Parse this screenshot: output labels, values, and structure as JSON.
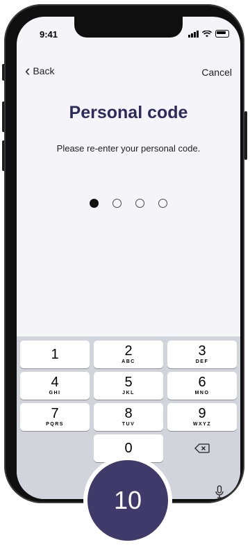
{
  "status": {
    "time": "9:41"
  },
  "nav": {
    "back_label": "Back",
    "cancel_label": "Cancel"
  },
  "title": "Personal code",
  "subtitle": "Please re-enter your personal code.",
  "pin": {
    "length": 4,
    "filled": 1
  },
  "keypad": {
    "k1": {
      "num": "1",
      "letters": ""
    },
    "k2": {
      "num": "2",
      "letters": "ABC"
    },
    "k3": {
      "num": "3",
      "letters": "DEF"
    },
    "k4": {
      "num": "4",
      "letters": "GHI"
    },
    "k5": {
      "num": "5",
      "letters": "JKL"
    },
    "k6": {
      "num": "6",
      "letters": "MNO"
    },
    "k7": {
      "num": "7",
      "letters": "PQRS"
    },
    "k8": {
      "num": "8",
      "letters": "TUV"
    },
    "k9": {
      "num": "9",
      "letters": "WXYZ"
    },
    "k0": {
      "num": "0",
      "letters": ""
    }
  },
  "badge": "10",
  "colors": {
    "title": "#2d2a5c",
    "badge": "#3f3a69",
    "screen": "#f4f4f9",
    "keyboard": "#d2d4db"
  },
  "icons": [
    "signal-icon",
    "wifi-icon",
    "battery-icon",
    "chevron-left-icon",
    "backspace-icon",
    "microphone-icon"
  ]
}
